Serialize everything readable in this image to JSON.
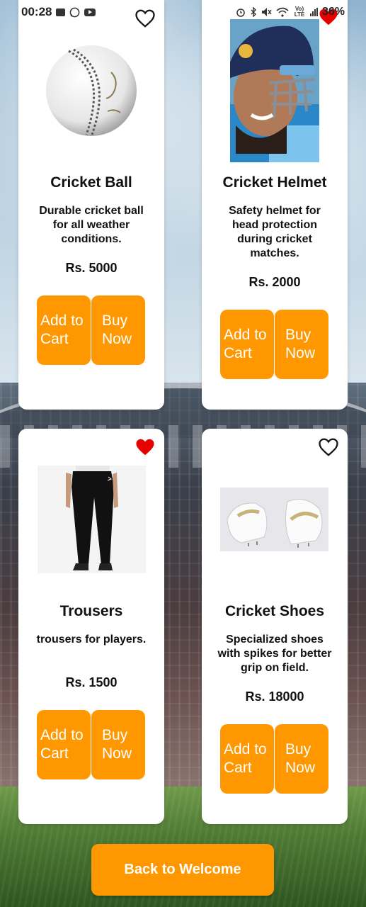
{
  "status_bar": {
    "time": "00:28",
    "network_label": "Vo) LTE",
    "battery": "36%",
    "icons": [
      "gallery-icon",
      "whatsapp-icon",
      "youtube-icon",
      "alarm-icon",
      "bluetooth-icon",
      "mute-icon",
      "wifi-icon",
      "signal-icon"
    ]
  },
  "colors": {
    "accent": "#ff9800",
    "heart_active": "#e60000",
    "card_bg": "#ffffff"
  },
  "products": [
    {
      "name": "Cricket Ball",
      "description": "Durable cricket ball for all weather conditions.",
      "price": "Rs. 5000",
      "favorite": false,
      "add_label": "Add to Cart",
      "buy_label": "Buy Now",
      "image_icon": "cricket-ball-image"
    },
    {
      "name": "Cricket Helmet",
      "description": "Safety helmet for head protection during cricket matches.",
      "price": "Rs. 2000",
      "favorite": true,
      "add_label": "Add to Cart",
      "buy_label": "Buy Now",
      "image_icon": "cricket-helmet-image"
    },
    {
      "name": "Trousers",
      "description": "trousers for players.",
      "price": "Rs. 1500",
      "favorite": true,
      "add_label": "Add to Cart",
      "buy_label": "Buy Now",
      "image_icon": "trousers-image"
    },
    {
      "name": "Cricket Shoes",
      "description": "Specialized shoes with spikes for better grip on field.",
      "price": "Rs. 18000",
      "favorite": false,
      "add_label": "Add to Cart",
      "buy_label": "Buy Now",
      "image_icon": "cricket-shoes-image"
    }
  ],
  "footer": {
    "back_label": "Back to Welcome"
  }
}
